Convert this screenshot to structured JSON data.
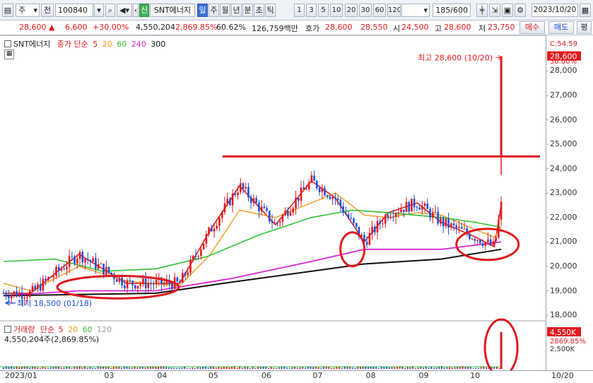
{
  "toolbar": {
    "period_select": "주",
    "prev_label": "전",
    "code": "100840",
    "sin_label": "신",
    "name": "SNT에너지",
    "period_tabs": [
      "일",
      "주",
      "월",
      "년",
      "분",
      "초",
      "틱"
    ],
    "active_period": "일",
    "intervals": [
      "1",
      "3",
      "5",
      "10",
      "20",
      "30",
      "60",
      "120"
    ],
    "count": "185",
    "count_total": "/600",
    "date": "2023/10/20"
  },
  "quote": {
    "price": "28,600",
    "change": "6,600",
    "change_pct": "+30.00%",
    "volume": "4,550,204",
    "volume_pct": "2,869.85%",
    "turnover": "60.62%",
    "amount": "126,759백만",
    "ask_label": "호가",
    "ask": "28,600",
    "bid": "28,550",
    "open_label": "시",
    "open": "24,500",
    "high_label": "고",
    "high": "28,600",
    "low_label": "저",
    "low": "23,750",
    "buy_btn": "매수",
    "sell_btn": "매도",
    "eval_btn": "평"
  },
  "legend": {
    "name": "SNT에너지",
    "ma_title": "종가 단순",
    "ma_periods": [
      "5",
      "20",
      "60",
      "240",
      "300"
    ],
    "vol_title": "거래량",
    "vol_ma_title": "단순",
    "vol_periods": [
      "5",
      "20",
      "60",
      "120"
    ],
    "vol_value": "4,550,204주(2,869.85%)"
  },
  "annotations": {
    "high_label": "최고 28,600 (10/20)",
    "low_label": "최저 18,500 (01/18)",
    "last_c": "C:54.59",
    "last_price": "28,600",
    "last_pct": "30.00%",
    "vol_last": "4,550K",
    "vol_pct": "2869.85%",
    "vol_tick": "2,500K"
  },
  "colors": {
    "up": "#e0191d",
    "down": "#1b4fd8",
    "ma5": "#e0191d",
    "ma20": "#f29a1a",
    "ma60": "#33c233",
    "ma240": "#d926d9",
    "ma300": "#111111",
    "annotation": "#e0191d"
  },
  "chart_data": {
    "type": "line",
    "title": "SNT에너지",
    "y_ticks": [
      "28,000",
      "27,000",
      "26,000",
      "25,000",
      "24,000",
      "23,000",
      "22,000",
      "21,000",
      "20,000",
      "19,000",
      "18,000"
    ],
    "ylim": [
      17800,
      29400
    ],
    "x_ticks": [
      "2023/01",
      "03",
      "04",
      "05",
      "06",
      "07",
      "08",
      "09",
      "10",
      "10/20"
    ],
    "series": [
      {
        "name": "5",
        "x": [
          "2023-01-02",
          "2023-01-18",
          "2023-02-15",
          "2023-03-15",
          "2023-04-15",
          "2023-05-03",
          "2023-05-20",
          "2023-06-10",
          "2023-07-01",
          "2023-07-15",
          "2023-08-01",
          "2023-08-15",
          "2023-09-01",
          "2023-09-15",
          "2023-10-05",
          "2023-10-16",
          "2023-10-20"
        ],
        "values": [
          18900,
          18900,
          20500,
          19300,
          19300,
          21500,
          23300,
          21700,
          23500,
          22800,
          21000,
          22200,
          22600,
          21800,
          21200,
          20800,
          22500
        ]
      },
      {
        "name": "20",
        "x": [
          "2023-01-02",
          "2023-01-18",
          "2023-02-15",
          "2023-03-15",
          "2023-04-15",
          "2023-05-03",
          "2023-05-20",
          "2023-06-10",
          "2023-07-01",
          "2023-07-15",
          "2023-08-01",
          "2023-08-15",
          "2023-09-01",
          "2023-09-15",
          "2023-10-05",
          "2023-10-16",
          "2023-10-20"
        ],
        "values": [
          19300,
          19000,
          20000,
          19400,
          19200,
          20500,
          22300,
          22000,
          22600,
          23000,
          22100,
          22000,
          22200,
          22100,
          21500,
          21200,
          21600
        ]
      },
      {
        "name": "60",
        "x": [
          "2023-01-02",
          "2023-02-01",
          "2023-03-01",
          "2023-04-01",
          "2023-05-01",
          "2023-06-01",
          "2023-07-01",
          "2023-07-25",
          "2023-08-15",
          "2023-09-15",
          "2023-10-05",
          "2023-10-20"
        ],
        "values": [
          20200,
          20300,
          19800,
          19900,
          20400,
          21300,
          22000,
          22300,
          22200,
          22000,
          21800,
          21600
        ]
      },
      {
        "name": "240",
        "x": [
          "2023-01-02",
          "2023-02-15",
          "2023-04-01",
          "2023-05-15",
          "2023-07-01",
          "2023-08-01",
          "2023-09-15",
          "2023-10-20"
        ],
        "values": [
          18800,
          19000,
          19000,
          19500,
          20200,
          20700,
          20700,
          21000
        ]
      },
      {
        "name": "300",
        "x": [
          "2023-01-02",
          "2023-02-15",
          "2023-04-01",
          "2023-05-15",
          "2023-07-01",
          "2023-08-01",
          "2023-09-15",
          "2023-10-20"
        ],
        "values": [
          18800,
          18850,
          18900,
          19350,
          19800,
          20100,
          20300,
          20700
        ]
      }
    ],
    "high": {
      "date": "10/20",
      "value": 28600
    },
    "low": {
      "date": "01/18",
      "value": 18500
    },
    "resistance": 24500,
    "volume_last": 4550204
  }
}
